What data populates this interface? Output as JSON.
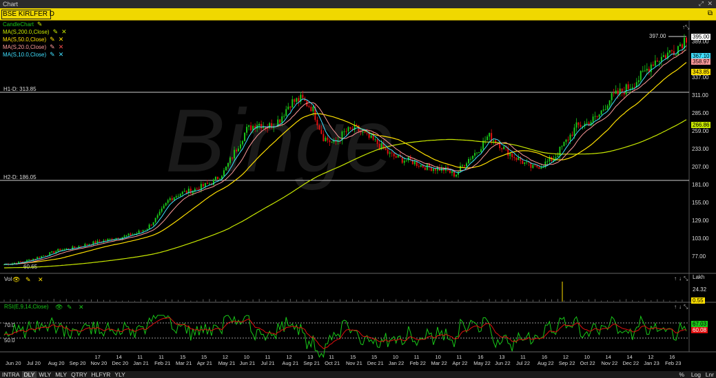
{
  "window": {
    "title": "Chart"
  },
  "symbol": {
    "name": "BSE KIRLFER D"
  },
  "legend": {
    "chart": "CandleChart",
    "ma": [
      {
        "label": "MA(S,200.0,Close)",
        "color": "#c8e800"
      },
      {
        "label": "MA(S,50.0,Close)",
        "color": "#ffe000"
      },
      {
        "label": "MA(S,20.0,Close)",
        "color": "#ff9a9a"
      },
      {
        "label": "MA(S,10.0,Close)",
        "color": "#40e0ff"
      }
    ]
  },
  "price_axis": {
    "ticks": [
      "389.00",
      "337.00",
      "311.00",
      "285.00",
      "259.00",
      "233.00",
      "207.00",
      "181.00",
      "155.00",
      "129.00",
      "103.00",
      "77.00"
    ],
    "tags": [
      {
        "text": "395.00",
        "bg": "#ffffff",
        "fg": "#000000"
      },
      {
        "text": "367.10",
        "bg": "#40e0ff",
        "fg": "#000000"
      },
      {
        "text": "358.97",
        "bg": "#ff9a9a",
        "fg": "#000000"
      },
      {
        "text": "343.85",
        "bg": "#ffe000",
        "fg": "#000000"
      },
      {
        "text": "266.86",
        "bg": "#c8e800",
        "fg": "#000000"
      }
    ]
  },
  "annotations": {
    "high": "397.00",
    "low": "60.65",
    "h1": "H1-D: 313.85",
    "h2": "H2-D: 186.05"
  },
  "watermark": "Binge",
  "volume": {
    "label": "Vol",
    "unit": "Lakh",
    "ticks": [
      "24.32"
    ],
    "tag": "0.55"
  },
  "rsi": {
    "label": "RSI(E,9,14,Close)",
    "levels": [
      "70.0",
      "50.0"
    ],
    "tags": [
      {
        "text": "67.03",
        "bg": "#19c819",
        "fg": "#000000"
      },
      {
        "text": "60.08",
        "bg": "#e01010",
        "fg": "#ffffff"
      }
    ]
  },
  "time_axis": {
    "labels": [
      [
        "",
        "Jun 20"
      ],
      [
        "",
        "Jul 20"
      ],
      [
        "",
        "Aug 20"
      ],
      [
        "",
        "Sep 20"
      ],
      [
        "17",
        "Nov 20"
      ],
      [
        "14",
        "Dec 20"
      ],
      [
        "11",
        "Jan 21"
      ],
      [
        "11",
        "Feb 21"
      ],
      [
        "15",
        "Mar 21"
      ],
      [
        "15",
        "Apr 21"
      ],
      [
        "12",
        "May 21"
      ],
      [
        "10",
        "Jun 21"
      ],
      [
        "11",
        "Jul 21"
      ],
      [
        "12",
        "Aug 21"
      ],
      [
        "13",
        "Sep 21"
      ],
      [
        "11",
        "Oct 21"
      ],
      [
        "15",
        "Nov 21"
      ],
      [
        "15",
        "Dec 21"
      ],
      [
        "10",
        "Jan 22"
      ],
      [
        "11",
        "Feb 22"
      ],
      [
        "10",
        "Mar 22"
      ],
      [
        "11",
        "Apr 22"
      ],
      [
        "16",
        "May 22"
      ],
      [
        "13",
        "Jun 22"
      ],
      [
        "11",
        "Jul 22"
      ],
      [
        "16",
        "Aug 22"
      ],
      [
        "12",
        "Sep 22"
      ],
      [
        "10",
        "Oct 22"
      ],
      [
        "14",
        "Nov 22"
      ],
      [
        "14",
        "Dec 22"
      ],
      [
        "12",
        "Jan 23"
      ],
      [
        "16",
        "Feb 23"
      ]
    ]
  },
  "timeframes": [
    "INTRA",
    "DLY",
    "WLY",
    "MLY",
    "QTRY",
    "HLFYR",
    "YLY"
  ],
  "selected_timeframe": "DLY",
  "bottom_right": [
    "%",
    "Log",
    "Lnr"
  ],
  "series": {
    "close_path": [
      65,
      67,
      70,
      75,
      80,
      86,
      88,
      92,
      96,
      99,
      103,
      106,
      110,
      118,
      135,
      160,
      168,
      172,
      178,
      185,
      200,
      230,
      260,
      270,
      265,
      275,
      300,
      305,
      292,
      250,
      240,
      258,
      262,
      250,
      240,
      225,
      218,
      215,
      208,
      205,
      203,
      195,
      215,
      230,
      252,
      240,
      225,
      215,
      205,
      210,
      220,
      242,
      265,
      270,
      280,
      305,
      315,
      325,
      340,
      360,
      368,
      378,
      395
    ]
  }
}
